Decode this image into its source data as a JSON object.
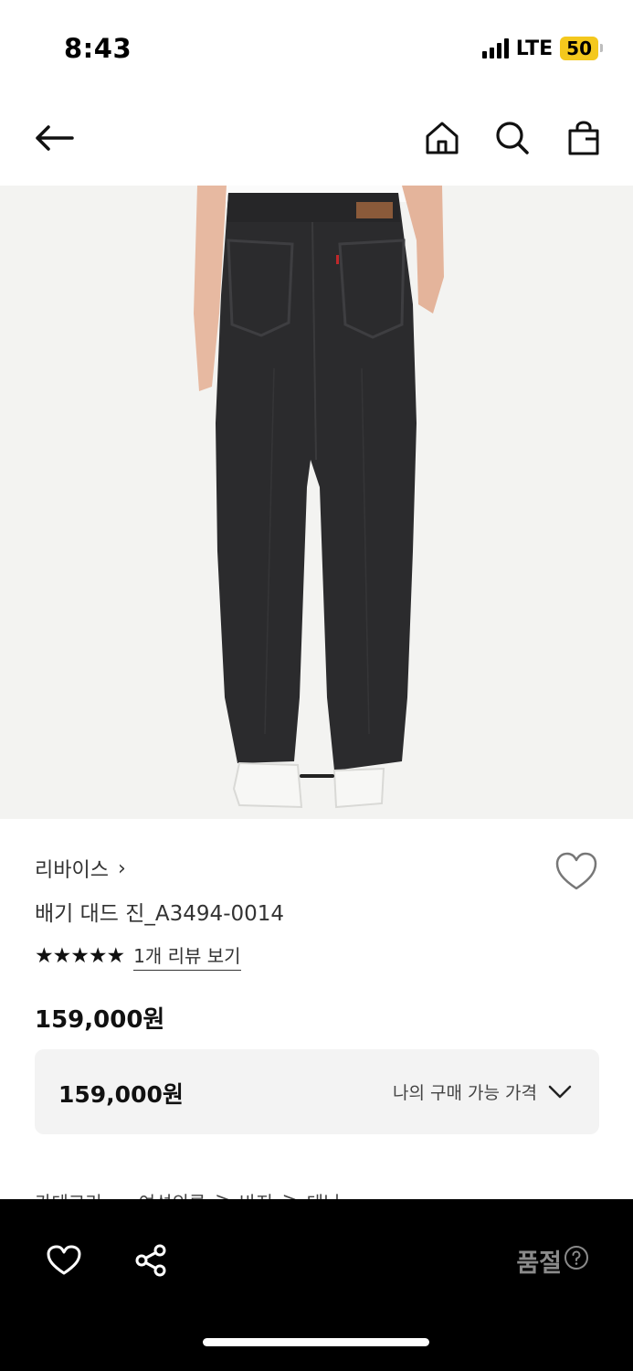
{
  "status_bar": {
    "time": "8:43",
    "network": "LTE",
    "battery": "50"
  },
  "nav": {
    "back_icon": "arrow-left-icon",
    "home_icon": "home-icon",
    "search_icon": "search-icon",
    "bag_icon": "shopping-bag-icon"
  },
  "hero": {
    "image": "product-photo-black-baggy-jeans",
    "slide_index": 1
  },
  "product": {
    "brand": "리바이스",
    "brand_chevron": "›",
    "name": "배기 대드 진_A3494-0014",
    "stars": "★★★★★",
    "rating_value": 5,
    "review_link": "1개 리뷰 보기",
    "price": "159,000원"
  },
  "price_box": {
    "value": "159,000원",
    "label": "나의 구매 가능 가격"
  },
  "category": {
    "label": "카테고리",
    "path": [
      "여성의류",
      ">",
      "바지",
      ">",
      "데님"
    ]
  },
  "bottom_bar": {
    "soldout_label": "품절",
    "help_icon": "question-circle-icon"
  },
  "colors": {
    "accent": "#000000",
    "battery": "#f4c81d",
    "price_box_bg": "#f3f3f3",
    "soldout_text": "#8a8a8a"
  }
}
